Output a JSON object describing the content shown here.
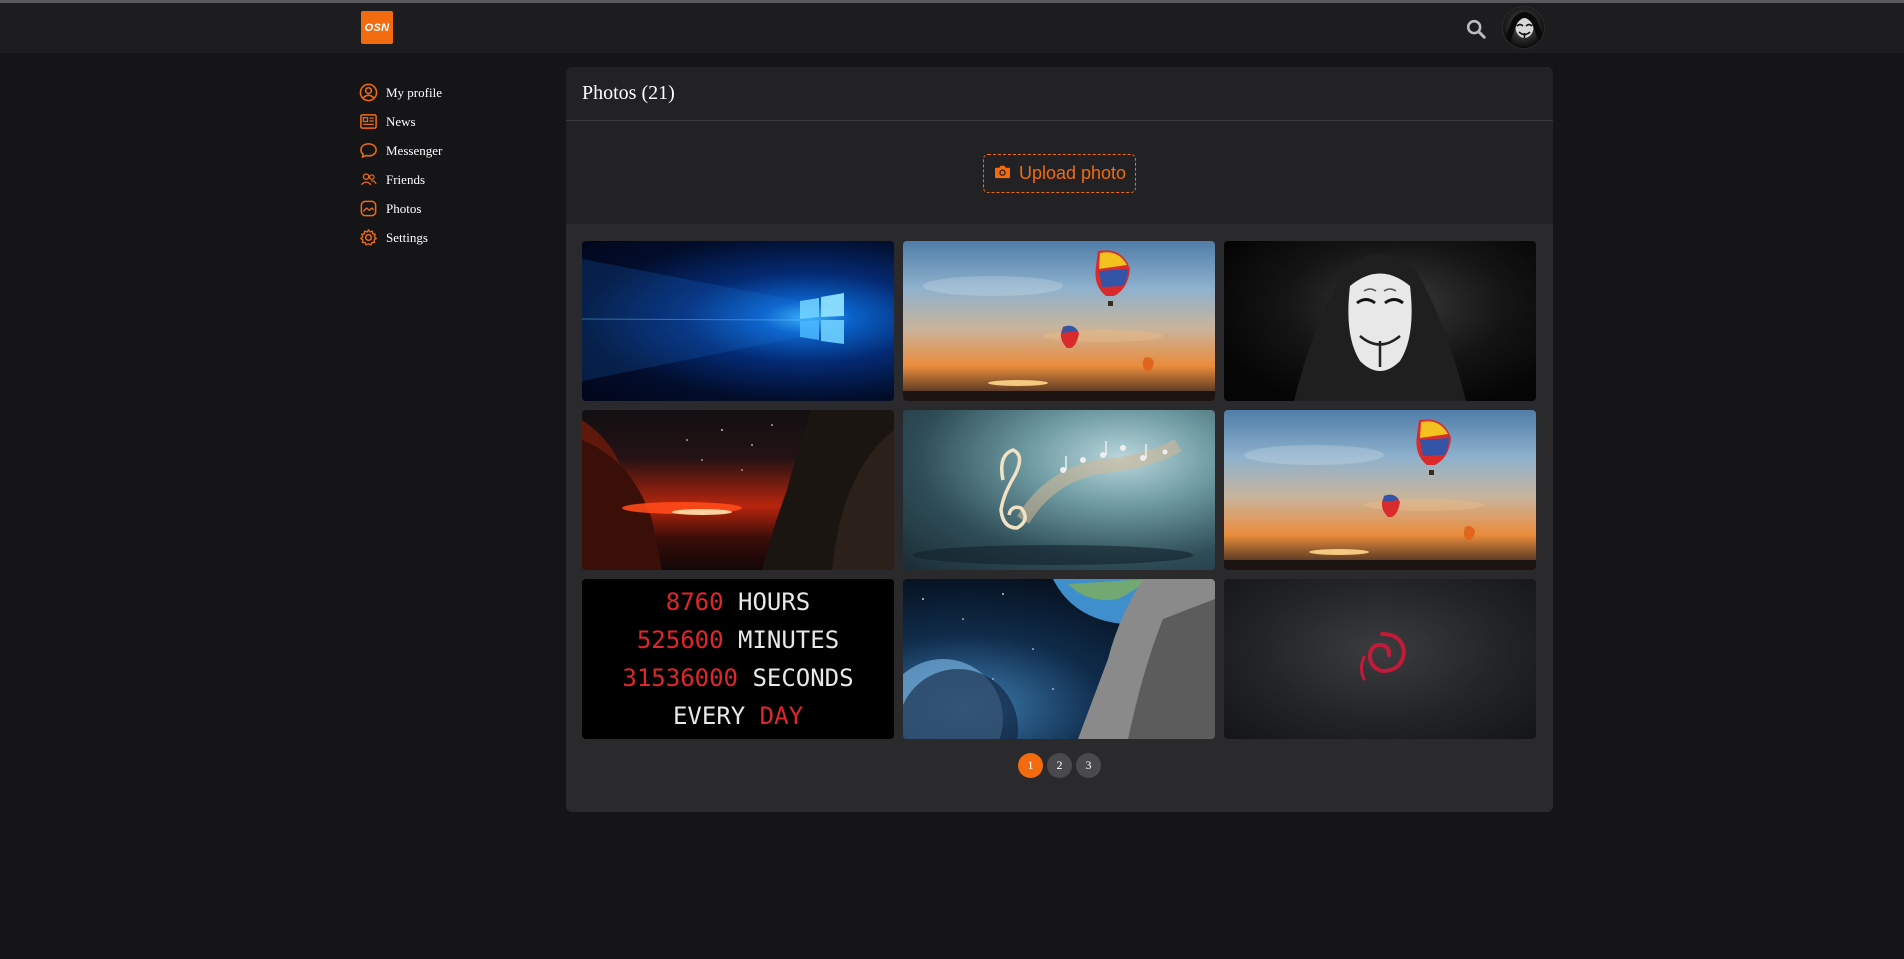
{
  "header": {
    "logo_text": "OSN",
    "search_icon": "search-icon",
    "avatar": "user-avatar"
  },
  "sidebar": {
    "items": [
      {
        "label": "My profile",
        "icon": "user-circle-icon"
      },
      {
        "label": "News",
        "icon": "newspaper-icon"
      },
      {
        "label": "Messenger",
        "icon": "chat-bubble-icon"
      },
      {
        "label": "Friends",
        "icon": "users-icon"
      },
      {
        "label": "Photos",
        "icon": "image-icon"
      },
      {
        "label": "Settings",
        "icon": "gear-icon"
      }
    ]
  },
  "main": {
    "title": "Photos (21)",
    "upload_label": "Upload photo",
    "upload_icon": "camera-icon",
    "photos": [
      {
        "subject": "windows-logo-wallpaper"
      },
      {
        "subject": "hot-air-balloons-sunset"
      },
      {
        "subject": "guy-fawkes-mask-hoodie"
      },
      {
        "subject": "red-sunset-trees-stars"
      },
      {
        "subject": "music-notes-treble-clef"
      },
      {
        "subject": "hot-air-balloons-sunset"
      },
      {
        "subject": "time-quote",
        "lines": [
          {
            "red": "8760",
            "white": "HOURS"
          },
          {
            "red": "525600",
            "white": "MINUTES"
          },
          {
            "red": "31536000",
            "white": "SECONDS"
          },
          {
            "white": "EVERY",
            "red": "DAY"
          }
        ]
      },
      {
        "subject": "planet-earth-space"
      },
      {
        "subject": "debian-swirl-logo"
      }
    ],
    "pagination": {
      "pages": [
        "1",
        "2",
        "3"
      ],
      "current": "1"
    }
  },
  "colors": {
    "accent": "#f26b0f",
    "background": "#151518",
    "panel": "#222225",
    "header": "#1d1d20"
  }
}
